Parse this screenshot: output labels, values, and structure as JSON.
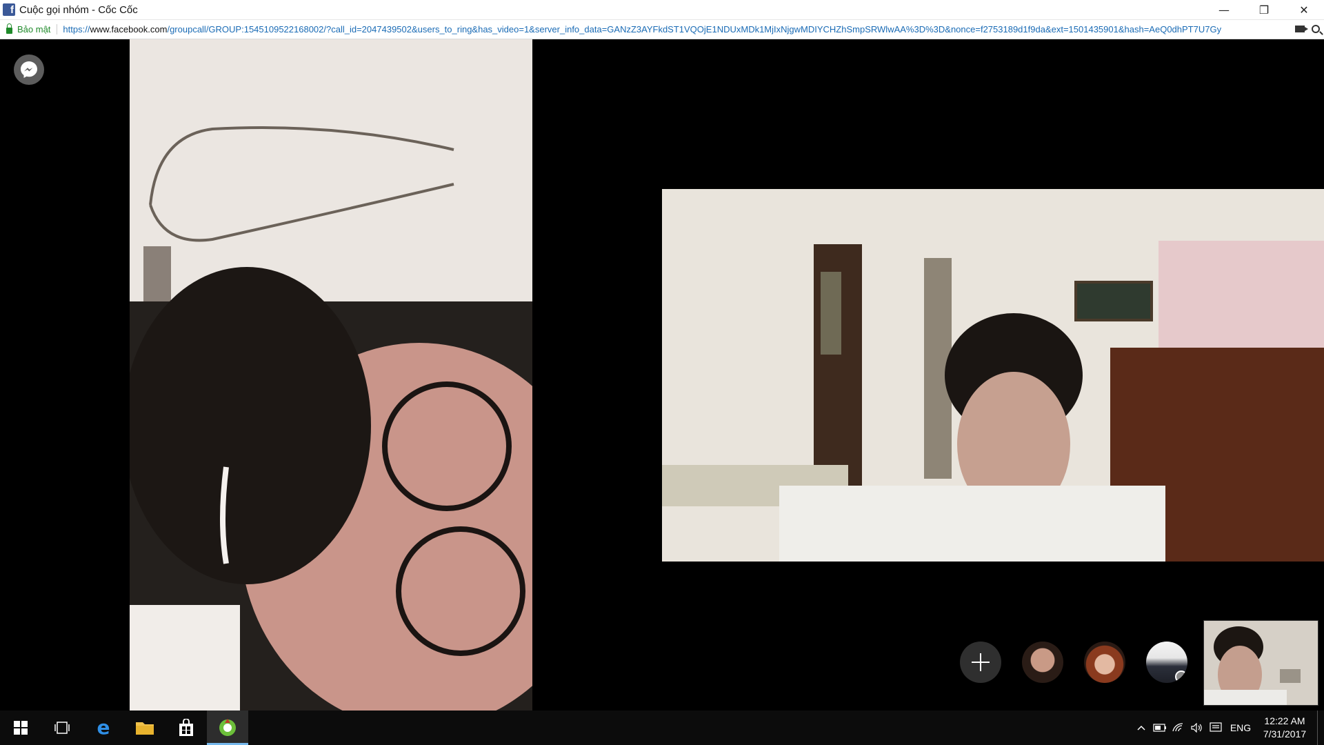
{
  "window": {
    "title": "Cuộc gọi nhóm - Cốc Cốc",
    "controls": {
      "minimize": "—",
      "restore": "❐",
      "close": "✕"
    }
  },
  "address_bar": {
    "secure_label": "Bảo mật",
    "url_scheme": "https://",
    "url_host": "www.facebook.com",
    "url_rest": "/groupcall/GROUP:1545109522168002/?call_id=2047439502&users_to_ring&has_video=1&server_info_data=GANzZ3AYFkdST1VQOjE1NDUxMDk1MjIxNjgwMDIYCHZhSmpSRWlwAA%3D%3D&nonce=f2753189d1f9da&ext=1501435901&hash=AeQ0dhPT7U7Gy"
  },
  "call": {
    "participants_count_visible": 3,
    "controls": {
      "add_label": "+"
    }
  },
  "taskbar": {
    "lang": "ENG",
    "time": "12:22 AM",
    "date": "7/31/2017"
  },
  "colors": {
    "facebook_blue": "#3b5998",
    "secure_green": "#1f8a2a",
    "url_blue": "#1a6bb5",
    "taskbar_bg": "#0c0c0c",
    "active_indicator": "#76b9ed"
  }
}
